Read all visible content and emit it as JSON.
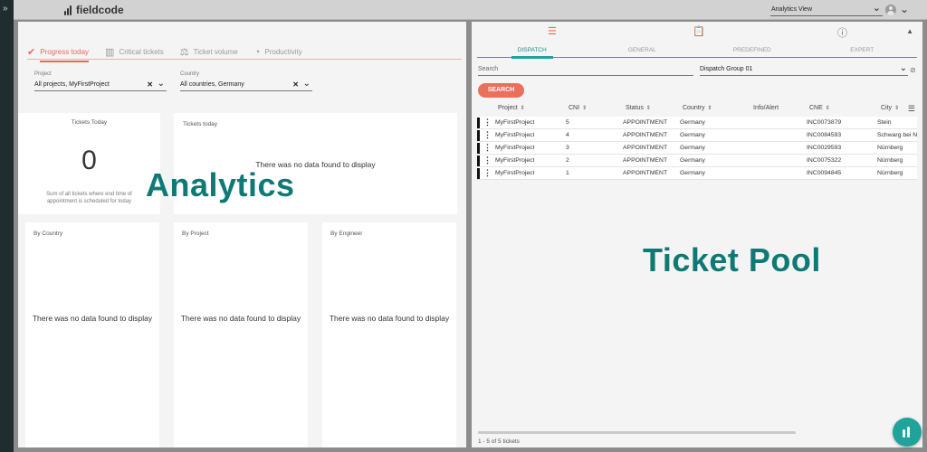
{
  "rail": {
    "toggle": "»"
  },
  "brand": {
    "name": "fieldcode"
  },
  "header": {
    "view_select": "Analytics View"
  },
  "analytics": {
    "tabs": [
      {
        "label": "Progress today"
      },
      {
        "label": "Critical tickets"
      },
      {
        "label": "Ticket volume"
      },
      {
        "label": "Productivity"
      }
    ],
    "project_filter": {
      "label": "Project",
      "value": "All projects, MyFirstProject"
    },
    "country_filter": {
      "label": "Country",
      "value": "All countries, Germany"
    },
    "tickets_today_count": {
      "title": "Tickets Today",
      "value": "0",
      "description": "Sum of all tickets where end time of appointment is scheduled for today"
    },
    "tickets_today_chart": {
      "title": "Tickets today",
      "empty": "There was no data found to display"
    },
    "by_country": {
      "title": "By Country",
      "empty": "There was no data found to display"
    },
    "by_project": {
      "title": "By Project",
      "empty": "There was no data found to display"
    },
    "by_engineer": {
      "title": "By Engineer",
      "empty": "There was no data found to display"
    },
    "overlay_label": "Analytics"
  },
  "ticket_pool": {
    "subtabs": [
      "DISPATCH",
      "GENERAL",
      "PREDEFINED",
      "EXPERT"
    ],
    "search_placeholder": "Search",
    "dispatch_group": "Dispatch Group 01",
    "search_button": "SEARCH",
    "columns": [
      "Project",
      "CNI",
      "Status",
      "Country",
      "Info/Alert",
      "CNE",
      "City"
    ],
    "rows": [
      {
        "project": "MyFirstProject",
        "cni": "5",
        "status": "APPOINTMENT",
        "country": "Germany",
        "info": "",
        "cne": "INC0073879",
        "city": "Stein"
      },
      {
        "project": "MyFirstProject",
        "cni": "4",
        "status": "APPOINTMENT",
        "country": "Germany",
        "info": "",
        "cne": "INC0084593",
        "city": "Schwarg bei Nü"
      },
      {
        "project": "MyFirstProject",
        "cni": "3",
        "status": "APPOINTMENT",
        "country": "Germany",
        "info": "",
        "cne": "INC0029593",
        "city": "Nürnberg"
      },
      {
        "project": "MyFirstProject",
        "cni": "2",
        "status": "APPOINTMENT",
        "country": "Germany",
        "info": "",
        "cne": "INC0075322",
        "city": "Nürnberg"
      },
      {
        "project": "MyFirstProject",
        "cni": "1",
        "status": "APPOINTMENT",
        "country": "Germany",
        "info": "",
        "cne": "INC0094845",
        "city": "Nürnberg"
      }
    ],
    "pagination": "1 - 5 of 5 tickets",
    "overlay_label": "Ticket Pool"
  },
  "colors": {
    "accent": "#e8695a",
    "teal": "#1fa39b",
    "rail": "#1f2d2f"
  }
}
